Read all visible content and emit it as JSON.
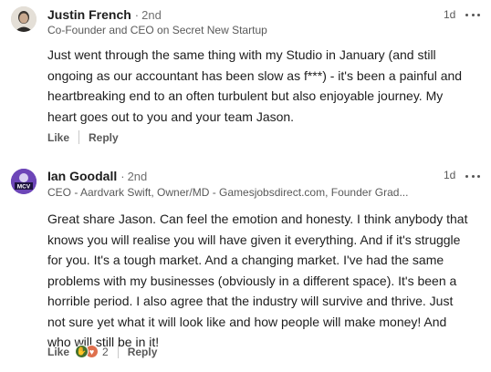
{
  "comments": [
    {
      "author": "Justin French",
      "degree": "2nd",
      "headline": "Co-Founder and CEO on Secret New Startup",
      "time": "1d",
      "text_lines": [
        "Just went through the same thing with my Studio in January (and still",
        "ongoing as our accountant has been slow as f***) - it's been a painful and",
        "heartbreaking end to an often turbulent but also enjoyable journey. My",
        "heart goes out to you and your team Jason."
      ],
      "like_label": "Like",
      "reply_label": "Reply"
    },
    {
      "author": "Ian Goodall",
      "degree": "2nd",
      "headline": "CEO - Aardvark Swift, Owner/MD - Gamesjobsdirect.com, Founder Grad...",
      "time": "1d",
      "text_lines": [
        "Great share Jason. Can feel the emotion and honesty. I think anybody that",
        "knows you will realise you will have given it everything. And if it's struggle",
        "for you. It's a tough market. And a changing market. I've had the same",
        "problems with my businesses (obviously in a different space). It's been a",
        "horrible period. I also agree that the industry will survive and thrive. Just",
        "not sure yet what it will look like and how people will make money! And",
        "who will still be in it!"
      ],
      "like_label": "Like",
      "reaction_count": "2",
      "reaction_icons": [
        "clap-icon",
        "heart-icon"
      ],
      "reply_label": "Reply",
      "avatar_text": "MCV"
    }
  ],
  "colors": {
    "clap": "#44712e",
    "heart": "#df704d",
    "avatar_bg": "#6d46b8"
  }
}
